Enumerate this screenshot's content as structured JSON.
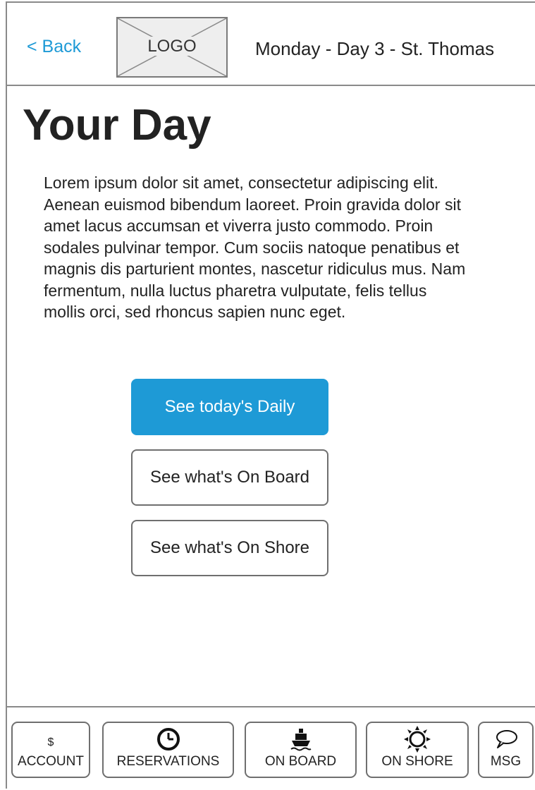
{
  "header": {
    "back_label": "< Back",
    "logo_label": "LOGO",
    "day_title": "Monday - Day 3 - St. Thomas"
  },
  "main": {
    "title": "Your Day",
    "intro": "Lorem ipsum dolor sit amet, consectetur adipiscing elit. Aenean euismod bibendum laoreet. Proin gravida dolor sit amet lacus accumsan et viverra justo commodo. Proin sodales pulvinar tempor. Cum sociis natoque penatibus et magnis dis parturient montes, nascetur ridiculus mus. Nam fermentum, nulla luctus pharetra vulputate, felis tellus mollis orci, sed rhoncus sapien nunc eget.",
    "buttons": {
      "daily": "See today's Daily",
      "on_board": "See what's On Board",
      "on_shore": "See what's On Shore"
    }
  },
  "bottom_nav": {
    "account": {
      "label": "ACCOUNT",
      "icon_text": "$",
      "icon": "dollar-icon"
    },
    "reservations": {
      "label": "RESERVATIONS",
      "icon": "clock-icon"
    },
    "on_board": {
      "label": "ON BOARD",
      "icon": "ship-icon"
    },
    "on_shore": {
      "label": "ON SHORE",
      "icon": "sun-icon"
    },
    "msg": {
      "label": "MSG",
      "icon": "speech-bubble-icon"
    }
  },
  "colors": {
    "accent": "#1e9ad6",
    "border": "#6f6f6f",
    "text": "#222222"
  }
}
